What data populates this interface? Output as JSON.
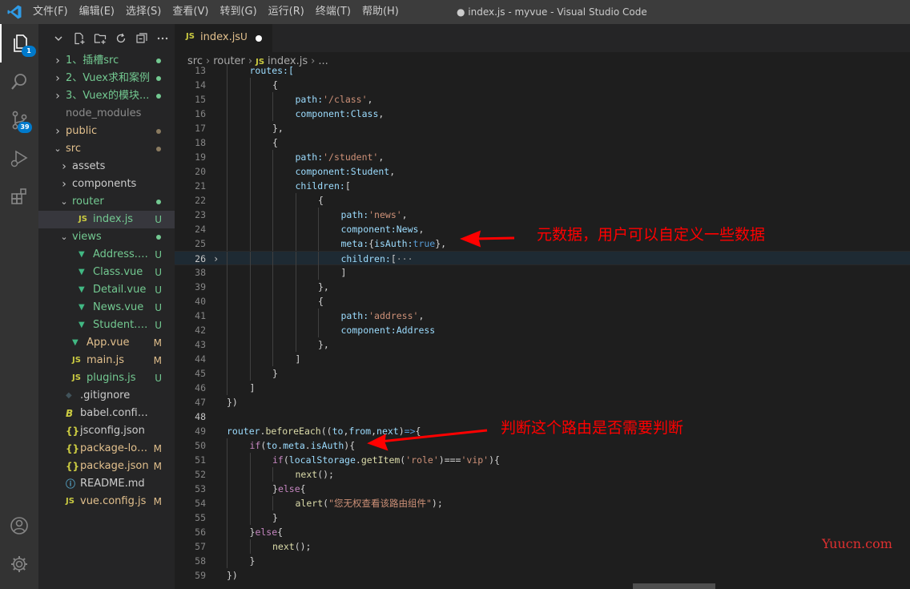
{
  "titlebar": {
    "menus": [
      "文件(F)",
      "编辑(E)",
      "选择(S)",
      "查看(V)",
      "转到(G)",
      "运行(R)",
      "终端(T)",
      "帮助(H)"
    ],
    "window_title": "● index.js - myvue - Visual Studio Code"
  },
  "activitybar": {
    "explorer_badge": "1",
    "scm_badge": "39"
  },
  "explorer": {
    "items": [
      {
        "label": "1、插槽src",
        "type": "folder",
        "state": "closed",
        "indent": 0,
        "color": "#73c991",
        "status": "dot",
        "status_color": "#73c991"
      },
      {
        "label": "2、Vuex求和案例",
        "type": "folder",
        "state": "closed",
        "indent": 0,
        "color": "#73c991",
        "status": "dot",
        "status_color": "#73c991"
      },
      {
        "label": "3、Vuex的模块...",
        "type": "folder",
        "state": "closed",
        "indent": 0,
        "color": "#73c991",
        "status": "dot",
        "status_color": "#73c991"
      },
      {
        "label": "node_modules",
        "type": "folder-plain",
        "state": "none",
        "indent": 0,
        "color": "#8c8c8c",
        "status": "",
        "status_color": ""
      },
      {
        "label": "public",
        "type": "folder",
        "state": "closed",
        "indent": 0,
        "color": "#e2c08d",
        "status": "dot",
        "status_color": "#8a7b60"
      },
      {
        "label": "src",
        "type": "folder",
        "state": "open",
        "indent": 0,
        "color": "#e2c08d",
        "status": "dot",
        "status_color": "#8a7b60"
      },
      {
        "label": "assets",
        "type": "folder",
        "state": "closed",
        "indent": 1,
        "color": "#cccccc",
        "status": "",
        "status_color": ""
      },
      {
        "label": "components",
        "type": "folder",
        "state": "closed",
        "indent": 1,
        "color": "#cccccc",
        "status": "",
        "status_color": ""
      },
      {
        "label": "router",
        "type": "folder",
        "state": "open",
        "indent": 1,
        "color": "#73c991",
        "status": "dot",
        "status_color": "#73c991"
      },
      {
        "label": "index.js",
        "type": "js",
        "state": "none",
        "indent": 2,
        "color": "#73c991",
        "status": "U",
        "status_color": "#73c991",
        "selected": true
      },
      {
        "label": "views",
        "type": "folder",
        "state": "open",
        "indent": 1,
        "color": "#73c991",
        "status": "dot",
        "status_color": "#73c991"
      },
      {
        "label": "Address.vue",
        "type": "vue",
        "state": "none",
        "indent": 2,
        "color": "#73c991",
        "status": "U",
        "status_color": "#73c991"
      },
      {
        "label": "Class.vue",
        "type": "vue",
        "state": "none",
        "indent": 2,
        "color": "#73c991",
        "status": "U",
        "status_color": "#73c991"
      },
      {
        "label": "Detail.vue",
        "type": "vue",
        "state": "none",
        "indent": 2,
        "color": "#73c991",
        "status": "U",
        "status_color": "#73c991"
      },
      {
        "label": "News.vue",
        "type": "vue",
        "state": "none",
        "indent": 2,
        "color": "#73c991",
        "status": "U",
        "status_color": "#73c991"
      },
      {
        "label": "Student.vue",
        "type": "vue",
        "state": "none",
        "indent": 2,
        "color": "#73c991",
        "status": "U",
        "status_color": "#73c991"
      },
      {
        "label": "App.vue",
        "type": "vue",
        "state": "none",
        "indent": 1,
        "color": "#e2c08d",
        "status": "M",
        "status_color": "#e2c08d"
      },
      {
        "label": "main.js",
        "type": "js",
        "state": "none",
        "indent": 1,
        "color": "#e2c08d",
        "status": "M",
        "status_color": "#e2c08d"
      },
      {
        "label": "plugins.js",
        "type": "js",
        "state": "none",
        "indent": 1,
        "color": "#73c991",
        "status": "U",
        "status_color": "#73c991"
      },
      {
        "label": ".gitignore",
        "type": "git",
        "state": "none",
        "indent": 0,
        "color": "#cccccc",
        "status": "",
        "status_color": ""
      },
      {
        "label": "babel.config.js",
        "type": "babel",
        "state": "none",
        "indent": 0,
        "color": "#cccccc",
        "status": "",
        "status_color": ""
      },
      {
        "label": "jsconfig.json",
        "type": "json",
        "state": "none",
        "indent": 0,
        "color": "#cccccc",
        "status": "",
        "status_color": ""
      },
      {
        "label": "package-lock.json",
        "type": "json",
        "state": "none",
        "indent": 0,
        "color": "#e2c08d",
        "status": "M",
        "status_color": "#e2c08d"
      },
      {
        "label": "package.json",
        "type": "json",
        "state": "none",
        "indent": 0,
        "color": "#e2c08d",
        "status": "M",
        "status_color": "#e2c08d"
      },
      {
        "label": "README.md",
        "type": "info",
        "state": "none",
        "indent": 0,
        "color": "#cccccc",
        "status": "",
        "status_color": ""
      },
      {
        "label": "vue.config.js",
        "type": "js",
        "state": "none",
        "indent": 0,
        "color": "#e2c08d",
        "status": "M",
        "status_color": "#e2c08d"
      }
    ]
  },
  "editor": {
    "tab": {
      "icon": "JS",
      "label": "index.js",
      "status": "U"
    },
    "breadcrumb": {
      "parts": [
        "src",
        "router",
        "index.js",
        "..."
      ],
      "js_icon": "JS"
    },
    "lines": [
      {
        "n": "13",
        "indent": 1,
        "tokens": [
          {
            "t": "routes:[",
            "c": "var"
          }
        ]
      },
      {
        "n": "14",
        "indent": 2,
        "tokens": [
          {
            "t": "{",
            "c": ""
          }
        ]
      },
      {
        "n": "15",
        "indent": 3,
        "tokens": [
          {
            "t": "path:",
            "c": "var"
          },
          {
            "t": "'/class'",
            "c": "str"
          },
          {
            "t": ",",
            "c": ""
          }
        ]
      },
      {
        "n": "16",
        "indent": 3,
        "tokens": [
          {
            "t": "component:",
            "c": "var"
          },
          {
            "t": "Class",
            "c": "var"
          },
          {
            "t": ",",
            "c": ""
          }
        ]
      },
      {
        "n": "17",
        "indent": 2,
        "tokens": [
          {
            "t": "},",
            "c": ""
          }
        ]
      },
      {
        "n": "18",
        "indent": 2,
        "tokens": [
          {
            "t": "{",
            "c": ""
          }
        ]
      },
      {
        "n": "19",
        "indent": 3,
        "tokens": [
          {
            "t": "path:",
            "c": "var"
          },
          {
            "t": "'/student'",
            "c": "str"
          },
          {
            "t": ",",
            "c": ""
          }
        ]
      },
      {
        "n": "20",
        "indent": 3,
        "tokens": [
          {
            "t": "component:",
            "c": "var"
          },
          {
            "t": "Student",
            "c": "var"
          },
          {
            "t": ",",
            "c": ""
          }
        ]
      },
      {
        "n": "21",
        "indent": 3,
        "tokens": [
          {
            "t": "children:",
            "c": "var"
          },
          {
            "t": "[",
            "c": ""
          }
        ]
      },
      {
        "n": "22",
        "indent": 4,
        "tokens": [
          {
            "t": "{",
            "c": ""
          }
        ]
      },
      {
        "n": "23",
        "indent": 5,
        "tokens": [
          {
            "t": "path:",
            "c": "var"
          },
          {
            "t": "'news'",
            "c": "str"
          },
          {
            "t": ",",
            "c": ""
          }
        ]
      },
      {
        "n": "24",
        "indent": 5,
        "tokens": [
          {
            "t": "component:",
            "c": "var"
          },
          {
            "t": "News",
            "c": "var"
          },
          {
            "t": ",",
            "c": ""
          }
        ]
      },
      {
        "n": "25",
        "indent": 5,
        "tokens": [
          {
            "t": "meta:",
            "c": "var"
          },
          {
            "t": "{",
            "c": ""
          },
          {
            "t": "isAuth:",
            "c": "var"
          },
          {
            "t": "true",
            "c": "blue"
          },
          {
            "t": "},",
            "c": ""
          }
        ]
      },
      {
        "n": "26",
        "indent": 5,
        "current": true,
        "fold": "›",
        "tokens": [
          {
            "t": "children:",
            "c": "var"
          },
          {
            "t": "[",
            "c": ""
          },
          {
            "t": "···",
            "c": "fold"
          }
        ]
      },
      {
        "n": "38",
        "indent": 5,
        "tokens": [
          {
            "t": "]",
            "c": ""
          }
        ]
      },
      {
        "n": "39",
        "indent": 4,
        "tokens": [
          {
            "t": "},",
            "c": ""
          }
        ]
      },
      {
        "n": "40",
        "indent": 4,
        "tokens": [
          {
            "t": "{",
            "c": ""
          }
        ]
      },
      {
        "n": "41",
        "indent": 5,
        "tokens": [
          {
            "t": "path:",
            "c": "var"
          },
          {
            "t": "'address'",
            "c": "str"
          },
          {
            "t": ",",
            "c": ""
          }
        ]
      },
      {
        "n": "42",
        "indent": 5,
        "tokens": [
          {
            "t": "component:",
            "c": "var"
          },
          {
            "t": "Address",
            "c": "var"
          }
        ]
      },
      {
        "n": "43",
        "indent": 4,
        "tokens": [
          {
            "t": "},",
            "c": ""
          }
        ]
      },
      {
        "n": "44",
        "indent": 3,
        "tokens": [
          {
            "t": "]",
            "c": ""
          }
        ]
      },
      {
        "n": "45",
        "indent": 2,
        "tokens": [
          {
            "t": "}",
            "c": ""
          }
        ]
      },
      {
        "n": "46",
        "indent": 1,
        "tokens": [
          {
            "t": "]",
            "c": ""
          }
        ]
      },
      {
        "n": "47",
        "indent": 0,
        "tokens": [
          {
            "t": "})",
            "c": ""
          }
        ]
      },
      {
        "n": "48",
        "indent": 0,
        "bold_num": true,
        "tokens": []
      },
      {
        "n": "49",
        "indent": 0,
        "tokens": [
          {
            "t": "router",
            "c": "var"
          },
          {
            "t": ".",
            "c": ""
          },
          {
            "t": "beforeEach",
            "c": "fn"
          },
          {
            "t": "((",
            "c": ""
          },
          {
            "t": "to",
            "c": "var"
          },
          {
            "t": ",",
            "c": ""
          },
          {
            "t": "from",
            "c": "var"
          },
          {
            "t": ",",
            "c": ""
          },
          {
            "t": "next",
            "c": "var"
          },
          {
            "t": ")",
            "c": ""
          },
          {
            "t": "=>",
            "c": "blue"
          },
          {
            "t": "{",
            "c": ""
          }
        ]
      },
      {
        "n": "50",
        "indent": 1,
        "tokens": [
          {
            "t": "if",
            "c": "kw"
          },
          {
            "t": "(",
            "c": ""
          },
          {
            "t": "to",
            "c": "var"
          },
          {
            "t": ".",
            "c": ""
          },
          {
            "t": "meta",
            "c": "var"
          },
          {
            "t": ".",
            "c": ""
          },
          {
            "t": "isAuth",
            "c": "var"
          },
          {
            "t": "){",
            "c": ""
          }
        ]
      },
      {
        "n": "51",
        "indent": 2,
        "tokens": [
          {
            "t": "if",
            "c": "kw"
          },
          {
            "t": "(",
            "c": ""
          },
          {
            "t": "localStorage",
            "c": "var"
          },
          {
            "t": ".",
            "c": ""
          },
          {
            "t": "getItem",
            "c": "fn"
          },
          {
            "t": "(",
            "c": ""
          },
          {
            "t": "'role'",
            "c": "str"
          },
          {
            "t": ")===",
            "c": ""
          },
          {
            "t": "'vip'",
            "c": "str"
          },
          {
            "t": "){",
            "c": ""
          }
        ]
      },
      {
        "n": "52",
        "indent": 3,
        "tokens": [
          {
            "t": "next",
            "c": "fn"
          },
          {
            "t": "();",
            "c": ""
          }
        ]
      },
      {
        "n": "53",
        "indent": 2,
        "tokens": [
          {
            "t": "}",
            "c": ""
          },
          {
            "t": "else",
            "c": "kw"
          },
          {
            "t": "{",
            "c": ""
          }
        ]
      },
      {
        "n": "54",
        "indent": 3,
        "tokens": [
          {
            "t": "alert",
            "c": "fn"
          },
          {
            "t": "(",
            "c": ""
          },
          {
            "t": "\"您无权查看该路由组件\"",
            "c": "str"
          },
          {
            "t": ");",
            "c": ""
          }
        ]
      },
      {
        "n": "55",
        "indent": 2,
        "tokens": [
          {
            "t": "}",
            "c": ""
          }
        ]
      },
      {
        "n": "56",
        "indent": 1,
        "tokens": [
          {
            "t": "}",
            "c": ""
          },
          {
            "t": "else",
            "c": "kw"
          },
          {
            "t": "{",
            "c": ""
          }
        ]
      },
      {
        "n": "57",
        "indent": 2,
        "tokens": [
          {
            "t": "next",
            "c": "fn"
          },
          {
            "t": "();",
            "c": ""
          }
        ]
      },
      {
        "n": "58",
        "indent": 1,
        "tokens": [
          {
            "t": "}",
            "c": ""
          }
        ]
      },
      {
        "n": "59",
        "indent": 0,
        "tokens": [
          {
            "t": "})",
            "c": ""
          }
        ]
      }
    ]
  },
  "annotations": {
    "meta_note": "元数据，用户可以自定义一些数据",
    "guard_note": "判断这个路由是否需要判断"
  },
  "watermark": "Yuucn.com",
  "colors": {
    "annotation": "#ff0000",
    "accent": "#007acc",
    "untracked": "#73c991",
    "modified": "#e2c08d"
  }
}
